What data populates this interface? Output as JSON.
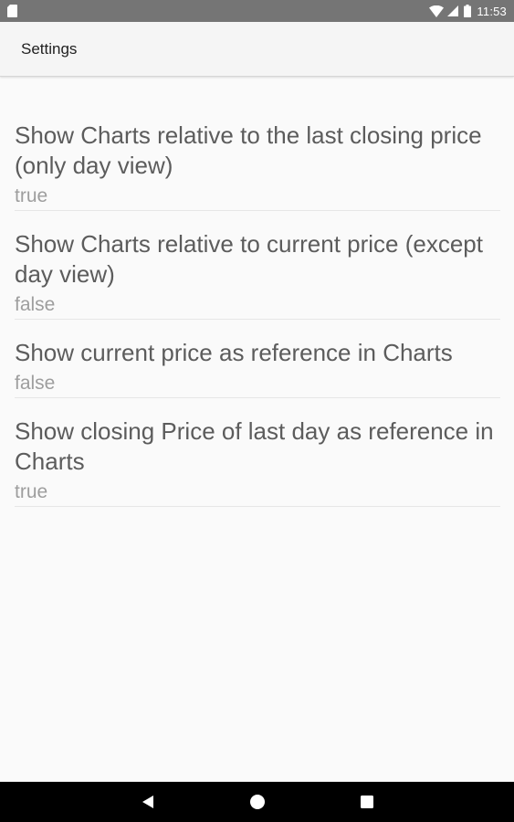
{
  "status_bar": {
    "time": "11:53",
    "icons": [
      "sd-card-icon",
      "wifi-icon",
      "signal-icon",
      "battery-icon"
    ]
  },
  "app_bar": {
    "title": "Settings"
  },
  "preferences": [
    {
      "title": "Show Charts relative to the last closing price (only day view)",
      "summary": "true"
    },
    {
      "title": "Show Charts relative to current price (except day view)",
      "summary": "false"
    },
    {
      "title": "Show current price as reference in Charts",
      "summary": "false"
    },
    {
      "title": "Show closing Price of last day as reference in Charts",
      "summary": "true"
    }
  ],
  "nav_bar": {
    "icons": [
      "back-icon",
      "home-icon",
      "recents-icon"
    ]
  },
  "colors": {
    "status_bar": "#757575",
    "background": "#fafafa",
    "title_text": "#5c5c5c",
    "summary_text": "#9e9e9e"
  }
}
